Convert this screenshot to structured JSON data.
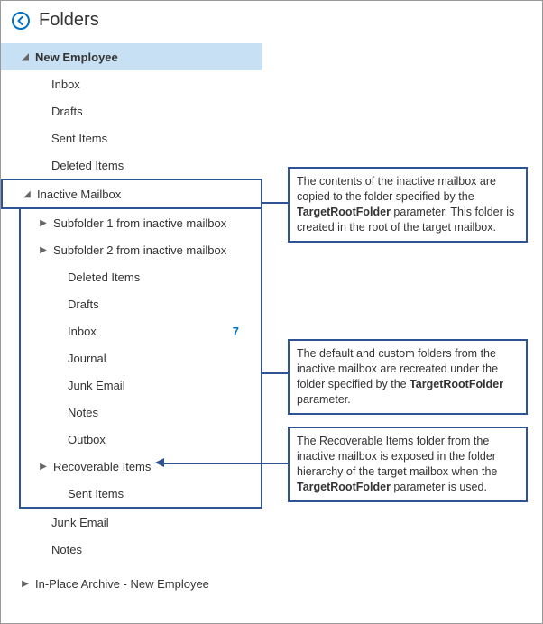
{
  "header": {
    "title": "Folders"
  },
  "root": {
    "label": "New Employee"
  },
  "rootChildren": {
    "inbox": "Inbox",
    "drafts": "Drafts",
    "sentItems": "Sent Items",
    "deletedItems": "Deleted Items"
  },
  "inactiveMailbox": {
    "label": "Inactive Mailbox"
  },
  "inactiveSubfolders": {
    "s1": "Subfolder 1 from inactive mailbox",
    "s2": "Subfolder 2 from inactive mailbox",
    "deleted": "Deleted Items",
    "drafts": "Drafts",
    "inbox": "Inbox",
    "inboxCount": "7",
    "journal": "Journal",
    "junk": "Junk Email",
    "notes": "Notes",
    "outbox": "Outbox",
    "recoverable": "Recoverable Items",
    "sent": "Sent Items"
  },
  "rootChildren2": {
    "junk": "Junk Email",
    "notes": "Notes"
  },
  "archive": {
    "label": "In-Place Archive - New Employee"
  },
  "callouts": {
    "c1a": "The contents of the inactive mailbox are copied to the folder specified by the ",
    "c1b": "TargetRootFolder",
    "c1c": " parameter. This folder is created in the root of the target mailbox.",
    "c2a": "The default and custom folders from the inactive mailbox are recreated under the folder specified by the ",
    "c2b": "TargetRootFolder",
    "c2c": " parameter.",
    "c3a": "The Recoverable Items folder from the inactive mailbox is exposed in the folder hierarchy of the target mailbox when the ",
    "c3b": "TargetRootFolder",
    "c3c": " parameter is used."
  }
}
